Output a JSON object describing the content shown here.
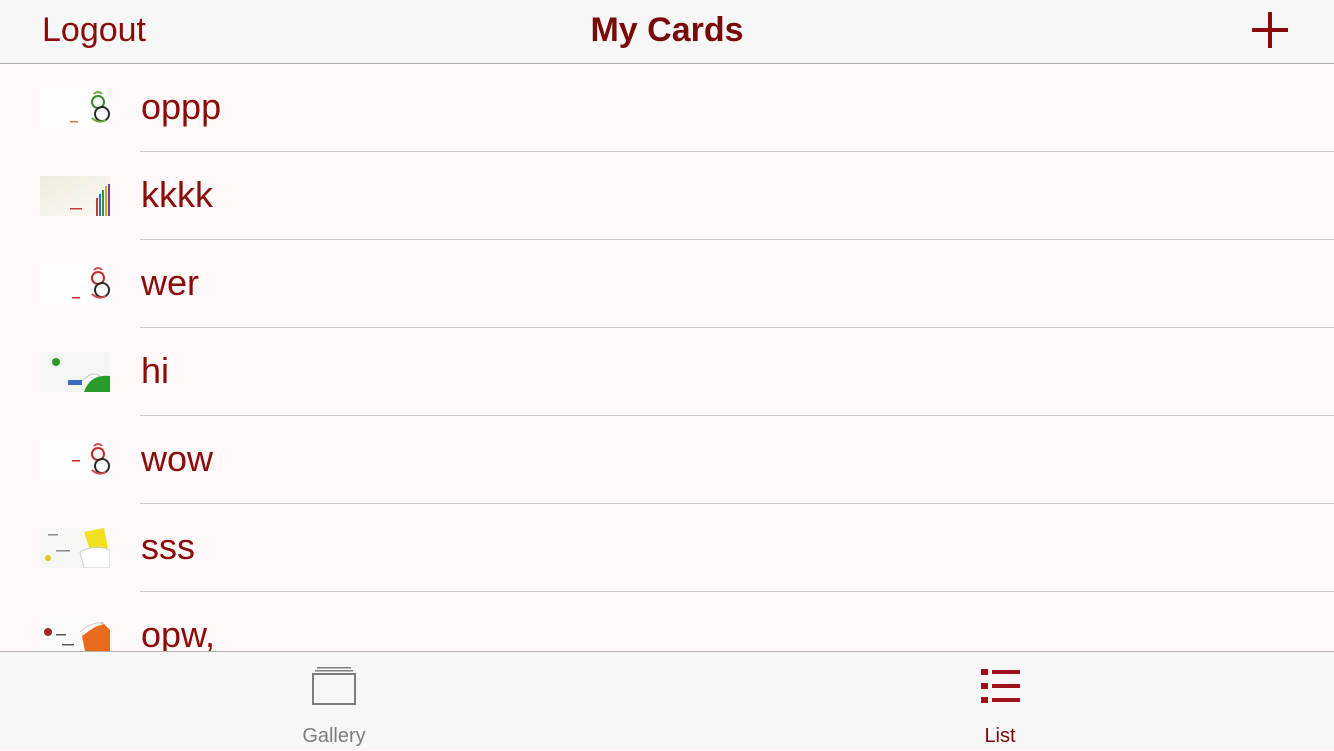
{
  "navbar": {
    "left_label": "Logout",
    "title": "My Cards",
    "add_icon": "plus-icon"
  },
  "cards": [
    {
      "name": "oppp",
      "thumb": "card-thumb-green-floral"
    },
    {
      "name": "kkkk",
      "thumb": "card-thumb-pencils"
    },
    {
      "name": "wer",
      "thumb": "card-thumb-red-floral"
    },
    {
      "name": "hi",
      "thumb": "card-thumb-green-leaf"
    },
    {
      "name": "wow",
      "thumb": "card-thumb-red-floral"
    },
    {
      "name": "sss",
      "thumb": "card-thumb-yellow"
    },
    {
      "name": "opw,",
      "thumb": "card-thumb-orange"
    }
  ],
  "tabbar": {
    "tabs": [
      {
        "label": "Gallery",
        "icon": "gallery-icon",
        "selected": false
      },
      {
        "label": "List",
        "icon": "list-icon",
        "selected": true
      }
    ]
  },
  "colors": {
    "accent": "#8b0a0a",
    "title": "#7a0a0a",
    "background": "#fff8f8",
    "tab_inactive": "#7d7d7d"
  }
}
